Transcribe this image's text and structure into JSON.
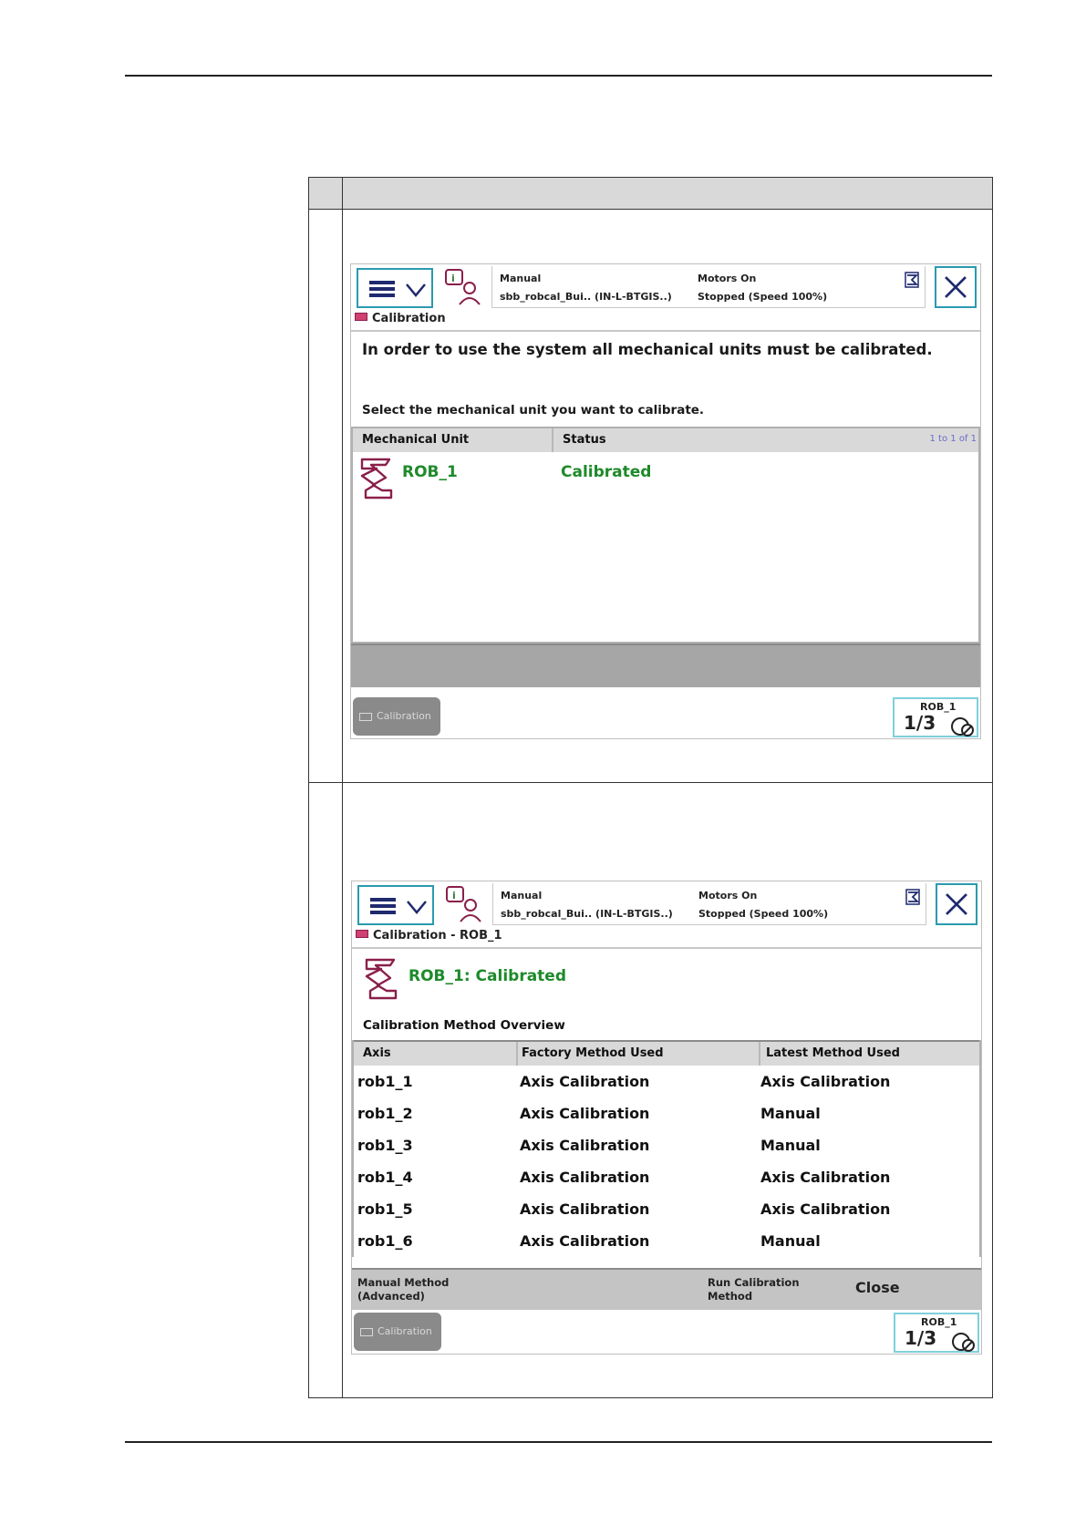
{
  "screen1": {
    "status": {
      "mode": "Manual",
      "system": "sbb_robcal_Bui.. (IN-L-BTGIS..)",
      "motors": "Motors On",
      "state": "Stopped (Speed 100%)"
    },
    "window_title": "Calibration",
    "intro": "In order to use the system all mechanical units must be calibrated.",
    "instruction": "Select the mechanical unit you want to calibrate.",
    "columns": [
      "Mechanical Unit",
      "Status"
    ],
    "paging": "1 to 1 of 1",
    "unit": {
      "name": "ROB_1",
      "status": "Calibrated"
    },
    "taskbar_label": "Calibration",
    "robot_label": "ROB_1",
    "fraction": "1/3"
  },
  "screen2": {
    "status": {
      "mode": "Manual",
      "system": "sbb_robcal_Bui.. (IN-L-BTGIS..)",
      "motors": "Motors On",
      "state": "Stopped (Speed 100%)"
    },
    "window_title": "Calibration - ROB_1",
    "unit_status": "ROB_1:  Calibrated",
    "overview_title": "Calibration Method Overview",
    "columns": [
      "Axis",
      "Factory Method Used",
      "Latest Method Used"
    ],
    "rows": [
      {
        "axis": "rob1_1",
        "factory": "Axis Calibration",
        "latest": "Axis Calibration"
      },
      {
        "axis": "rob1_2",
        "factory": "Axis Calibration",
        "latest": "Manual"
      },
      {
        "axis": "rob1_3",
        "factory": "Axis Calibration",
        "latest": "Manual"
      },
      {
        "axis": "rob1_4",
        "factory": "Axis Calibration",
        "latest": "Axis Calibration"
      },
      {
        "axis": "rob1_5",
        "factory": "Axis Calibration",
        "latest": "Axis Calibration"
      },
      {
        "axis": "rob1_6",
        "factory": "Axis Calibration",
        "latest": "Manual"
      }
    ],
    "commands": {
      "manual_line1": "Manual Method",
      "manual_line2": "(Advanced)",
      "run_line1": "Run Calibration",
      "run_line2": "Method",
      "close": "Close"
    },
    "taskbar_label": "Calibration",
    "robot_label": "ROB_1",
    "fraction": "1/3"
  },
  "colors": {
    "accent_border": "#2a9ab0",
    "status_green": "#1e8a2a",
    "robot_icon": "#8a1f4a",
    "header_gray": "#d9d9d9"
  },
  "icons": [
    "menu-icon",
    "event-log-icon",
    "quickset-icon",
    "close-icon",
    "robot-arm-icon",
    "calibration-icon",
    "jog-icon"
  ]
}
